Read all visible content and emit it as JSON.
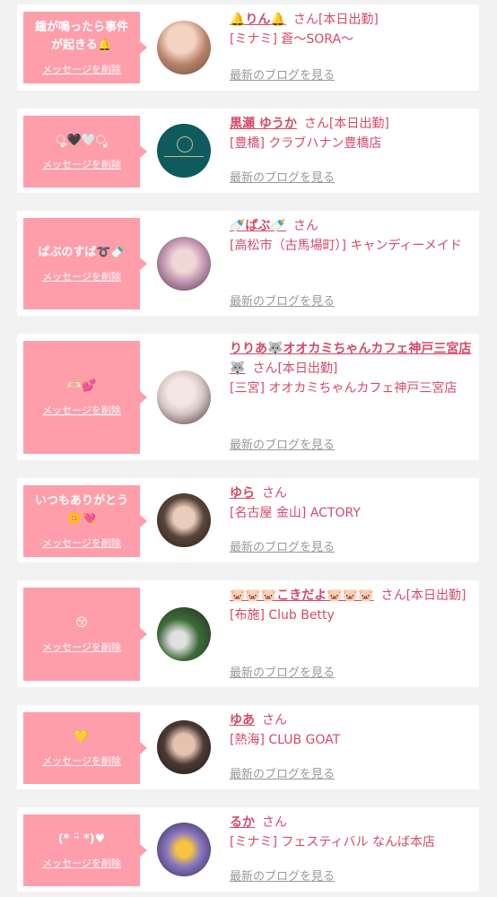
{
  "items": [
    {
      "message": "鐘が鳴ったら事件\nが起きる🔔",
      "delete_label": "メッセージを削除",
      "name": "🔔りん🔔",
      "honorific": "さん",
      "status": "[本日出勤]",
      "shop": "[ミナミ] 蒼〜SORA〜",
      "blog_label": "最新のブログを見る",
      "avatar_color": "#b8826a"
    },
    {
      "message": "ೄ🖤🤍ೃ",
      "delete_label": "メッセージを削除",
      "name": "黒瀬 ゆうか",
      "honorific": "さん",
      "status": "[本日出勤]",
      "shop": "[豊橋] クラブハナン豊橋店",
      "blog_label": "最新のブログを見る",
      "avatar_color": "#0e5a5c"
    },
    {
      "message": "ぱぶのすば➰🍼",
      "delete_label": "メッセージを削除",
      "name": "🍼ぱぶ🍼",
      "honorific": "さん",
      "status": "",
      "shop": "[高松市（古馬場町）] キャンディーメイド",
      "blog_label": "最新のブログを見る",
      "avatar_color": "#c79bb5"
    },
    {
      "message": "🫶🏻💕",
      "delete_label": "メッセージを削除",
      "name": "りりあ🐺オオカミちゃんカフェ神戸三宮店🐺",
      "honorific": "さん",
      "status": "[本日出勤]",
      "shop": "[三宮] オオカミちゃんカフェ神戸三宮店",
      "blog_label": "最新のブログを見る",
      "avatar_color": "#d7c7c4"
    },
    {
      "message": "いつもありがとう\n🌼💘",
      "delete_label": "メッセージを削除",
      "name": "ゆら",
      "honorific": "さん",
      "status": "",
      "shop": "[名古屋 金山] ACTORY",
      "blog_label": "最新のブログを見る",
      "avatar_color": "#5a4538"
    },
    {
      "message": "😚",
      "delete_label": "メッセージを削除",
      "name": "🐷🐷🐷こきだよ🐷🐷🐷",
      "honorific": "さん",
      "status": "[本日出勤]",
      "shop": "[布施] Club Betty",
      "blog_label": "最新のブログを見る",
      "avatar_color": "#3e6b3a"
    },
    {
      "message": "💛",
      "delete_label": "メッセージを削除",
      "name": "ゆあ",
      "honorific": "さん",
      "status": "",
      "shop": "[熱海] CLUB GOAT",
      "blog_label": "最新のブログを見る",
      "avatar_color": "#4b3a36"
    },
    {
      "message": "(* ᵕ̈ *)♥",
      "delete_label": "メッセージを削除",
      "name": "るか",
      "honorific": "さん",
      "status": "",
      "shop": "[ミナミ] フェスティバル なんば本店",
      "blog_label": "最新のブログを見る",
      "avatar_color": "#8a78c4"
    }
  ]
}
